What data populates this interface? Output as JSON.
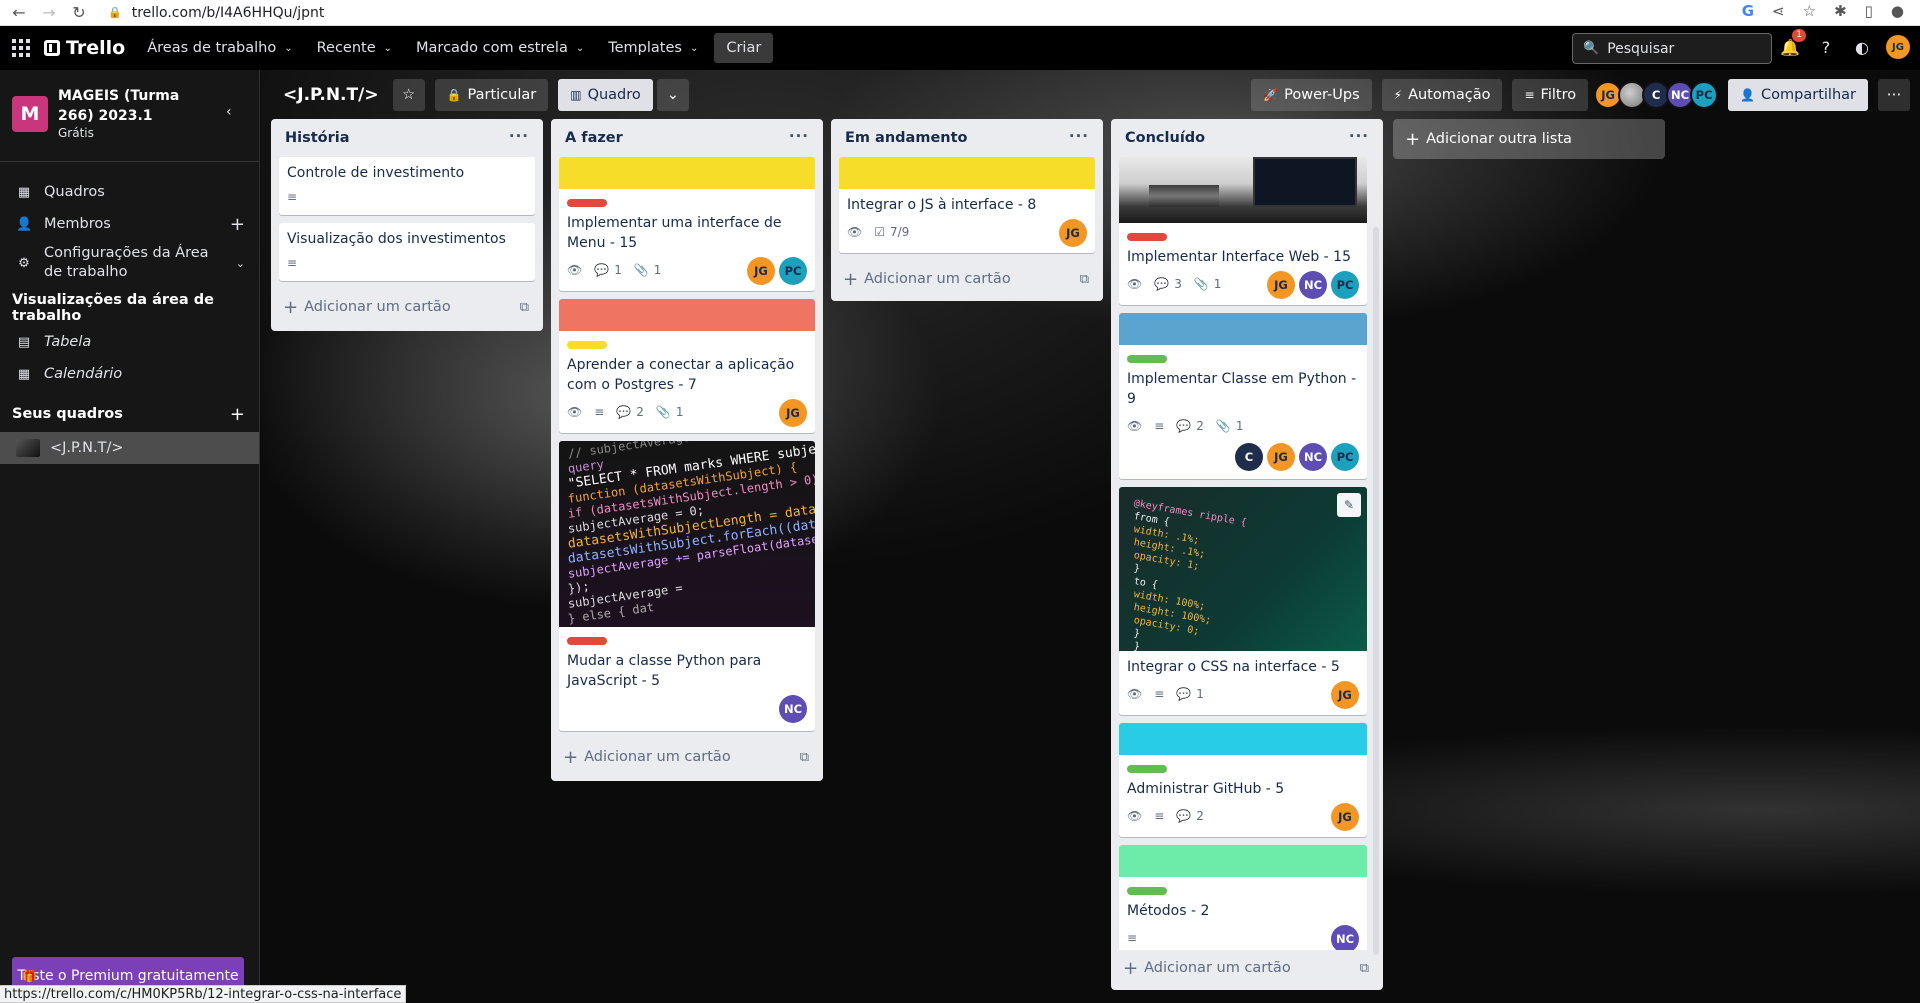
{
  "browser": {
    "url": "trello.com/b/I4A6HHQu/jpnt"
  },
  "header": {
    "logo": "Trello",
    "menu": [
      {
        "label": "Áreas de trabalho"
      },
      {
        "label": "Recente"
      },
      {
        "label": "Marcado com estrela"
      },
      {
        "label": "Templates"
      }
    ],
    "create_label": "Criar",
    "search_placeholder": "Pesquisar",
    "notification_count": "1",
    "user_initials": "JG"
  },
  "sidebar": {
    "workspace_name": "MAGEIS (Turma 266) 2023.1",
    "workspace_initial": "M",
    "workspace_plan": "Grátis",
    "items": [
      {
        "label": "Quadros"
      },
      {
        "label": "Membros"
      },
      {
        "label": "Configurações da Área de trabalho"
      }
    ],
    "views_heading": "Visualizações da área de trabalho",
    "views": [
      {
        "label": "Tabela"
      },
      {
        "label": "Calendário"
      }
    ],
    "boards_heading": "Seus quadros",
    "boards": [
      {
        "label": "<J.P.N.T/>"
      }
    ],
    "premium_label": "Teste o Premium gratuitamente"
  },
  "board": {
    "name": "<J.P.N.T/>",
    "visibility": "Particular",
    "view": "Quadro",
    "powerups": "Power-Ups",
    "automation": "Automação",
    "filter": "Filtro",
    "share": "Compartilhar",
    "members": [
      "JG",
      "",
      "C",
      "NC",
      "PC"
    ],
    "add_list": "Adicionar outra lista",
    "add_card": "Adicionar um cartão"
  },
  "lists": [
    {
      "title": "História",
      "cards": [
        {
          "title": "Controle de investimento"
        },
        {
          "title": "Visualização dos investimentos"
        }
      ]
    },
    {
      "title": "A fazer",
      "cards": [
        {
          "cover_color": "#f5dd29",
          "label_color": "#e2483d",
          "title": "Implementar uma interface de Menu - 15",
          "comments": "1",
          "attachments": "1",
          "members": [
            "JG",
            "PC"
          ]
        },
        {
          "cover_color": "#f07462",
          "label_color": "#f5dd29",
          "title": "Aprender a conectar a aplicação com o Postgres - 7",
          "comments": "2",
          "attachments": "1",
          "members": [
            "JG"
          ]
        },
        {
          "label_color": "#e2483d",
          "title": "Mudar a classe Python para JavaScript - 5",
          "members": [
            "NC"
          ]
        }
      ]
    },
    {
      "title": "Em andamento",
      "cards": [
        {
          "cover_color": "#f5dd29",
          "title": "Integrar o JS à interface - 8",
          "checklist": "7/9",
          "members": [
            "JG"
          ]
        }
      ]
    },
    {
      "title": "Concluído",
      "cards": [
        {
          "label_color": "#e2483d",
          "title": "Implementar Interface Web - 15",
          "comments": "3",
          "attachments": "1",
          "members": [
            "JG",
            "NC",
            "PC"
          ]
        },
        {
          "cover_color": "#5ba4cf",
          "label_color": "#61bd4f",
          "title": "Implementar Classe em Python - 9",
          "comments": "2",
          "attachments": "1",
          "members": [
            "C",
            "JG",
            "NC",
            "PC"
          ]
        },
        {
          "title": "Integrar o CSS na interface - 5",
          "comments": "1",
          "members": [
            "JG"
          ]
        },
        {
          "cover_color": "#29cce5",
          "label_color": "#61bd4f",
          "title": "Administrar GitHub - 5",
          "comments": "2",
          "members": [
            "JG"
          ]
        },
        {
          "cover_color": "#6deca9",
          "label_color": "#61bd4f",
          "title": "Métodos - 2",
          "members": [
            "NC"
          ]
        }
      ]
    }
  ],
  "code_snippet_1": [
    "// subjectAverage",
    "query",
    "\"SELECT * FROM marks WHERE subject_ID=\" + subject",
    "function (datasetsWithSubject) {",
    "  if (datasetsWithSubject.length > 0) {",
    "    subjectAverage = 0;",
    "    datasetsWithSubjectLength = datasetsWithSu",
    "    datasetsWithSubject.forEach((dataset) => {",
    "      subjectAverage += parseFloat(dataset[",
    "    });",
    "    subjectAverage =",
    "  } else {  dat"
  ],
  "code_snippet_2": [
    "@keyframes ripple {",
    "  from {",
    "    width: .1%;",
    "    height: .1%;",
    "    opacity: 1;",
    "  }",
    "  to {",
    "    width: 100%;",
    "    height: 100%;",
    "    opacity: 0;",
    "  }",
    "}"
  ],
  "status_url": "https://trello.com/c/HM0KP5Rb/12-integrar-o-css-na-interface"
}
